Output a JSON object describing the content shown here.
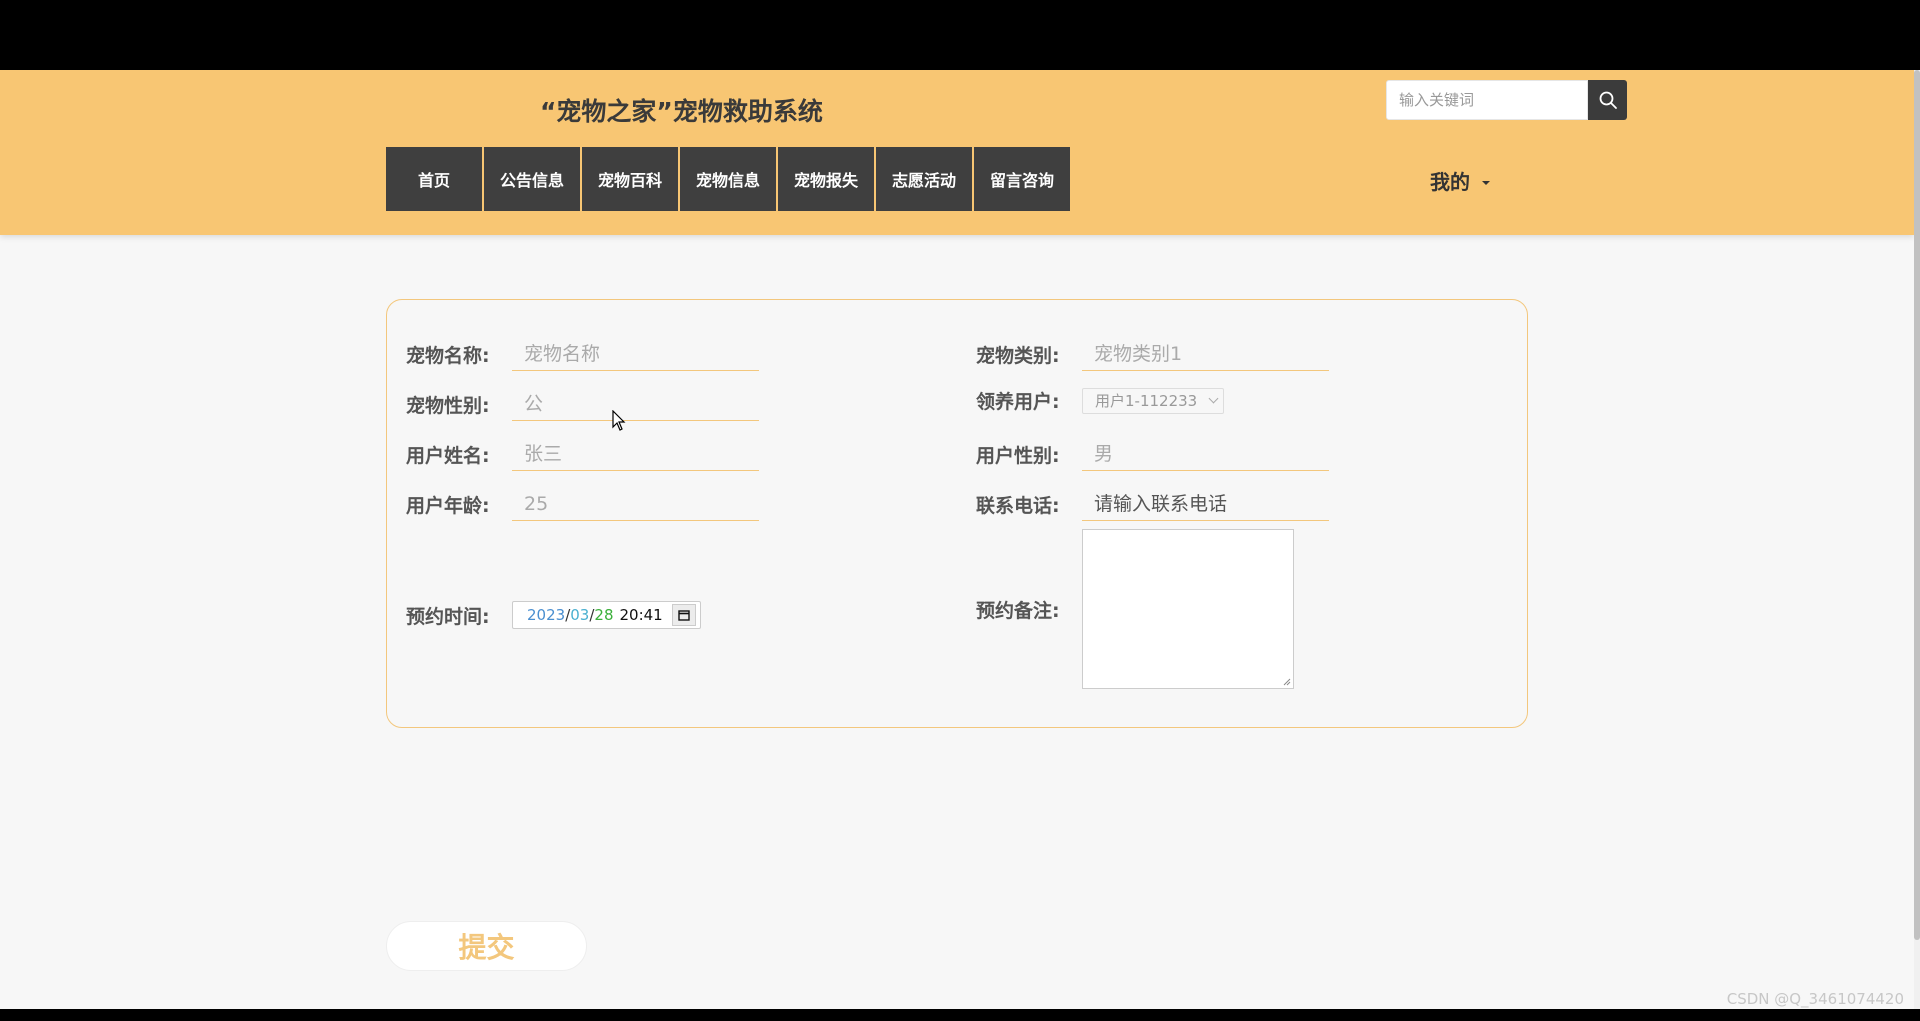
{
  "header": {
    "site_title": "“宠物之家”宠物救助系统",
    "search_placeholder": "输入关键词",
    "nav": [
      "首页",
      "公告信息",
      "宠物百科",
      "宠物信息",
      "宠物报失",
      "志愿活动",
      "留言咨询"
    ],
    "mine_label": "我的"
  },
  "form": {
    "pet_name": {
      "label": "宠物名称:",
      "placeholder": "宠物名称"
    },
    "pet_category": {
      "label": "宠物类别:",
      "placeholder": "宠物类别1"
    },
    "pet_gender": {
      "label": "宠物性别:",
      "placeholder": "公"
    },
    "adopt_user": {
      "label": "领养用户:",
      "value": "用户1-112233"
    },
    "user_name": {
      "label": "用户姓名:",
      "placeholder": "张三"
    },
    "user_gender": {
      "label": "用户性别:",
      "placeholder": "男"
    },
    "user_age": {
      "label": "用户年龄:",
      "placeholder": "25"
    },
    "phone": {
      "label": "联系电话:",
      "placeholder": "请输入联系电话"
    },
    "appointment_time": {
      "label": "预约时间:",
      "year": "2023",
      "month": "03",
      "day": "28",
      "sep": "/",
      "time": "20:41"
    },
    "appointment_note": {
      "label": "预约备注:"
    },
    "submit_label": "提交"
  },
  "watermark": "CSDN @Q_3461074420",
  "colors": {
    "header_bg": "#f8c673",
    "nav_bg": "#3f3f3f",
    "accent": "#f3c77d"
  }
}
